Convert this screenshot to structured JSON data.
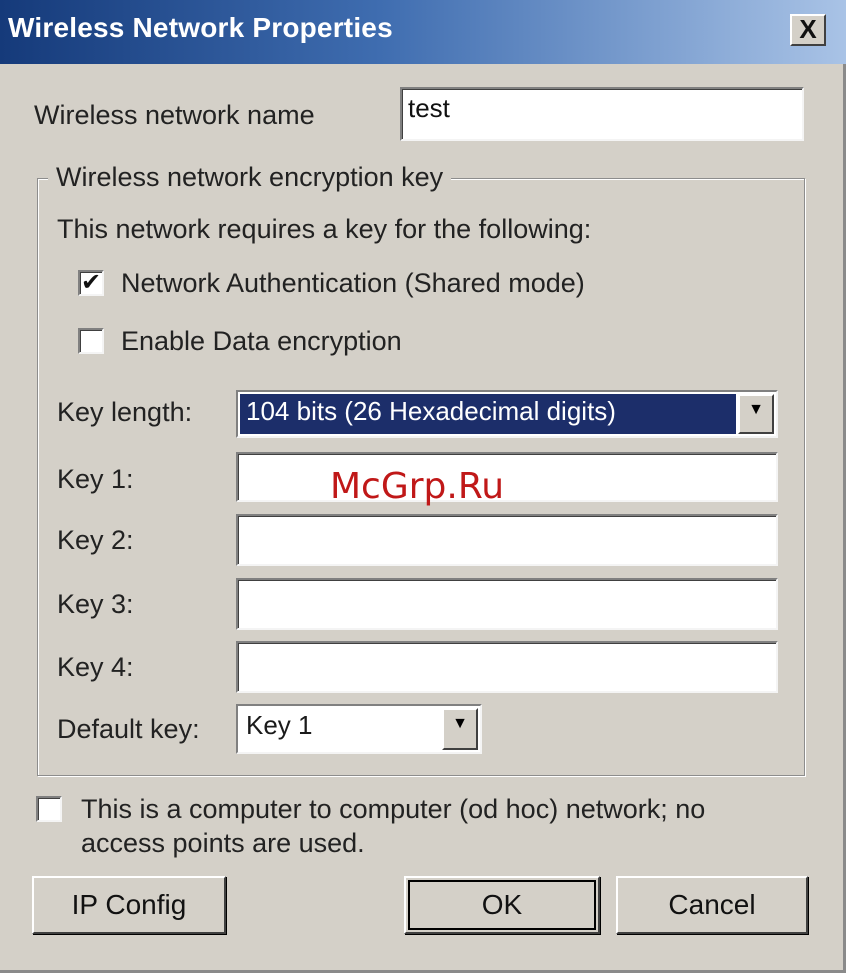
{
  "window": {
    "title": "Wireless Network Properties",
    "close_label": "X"
  },
  "network_name": {
    "label": "Wireless network name",
    "value": "test"
  },
  "encryption": {
    "group_label": "Wireless network encryption key",
    "intro": "This network requires a key for the following:",
    "network_auth": {
      "label": "Network  Authentication (Shared mode)",
      "checked": true,
      "check_glyph": "✔"
    },
    "data_encryption": {
      "label": "Enable Data encryption",
      "checked": false,
      "check_glyph": ""
    },
    "key_length": {
      "label": "Key length:",
      "value": "104 bits (26 Hexadecimal digits)"
    },
    "keys": [
      {
        "label": "Key 1:",
        "value": ""
      },
      {
        "label": "Key 2:",
        "value": ""
      },
      {
        "label": "Key 3:",
        "value": ""
      },
      {
        "label": "Key 4:",
        "value": ""
      }
    ],
    "default_key": {
      "label": "Default key:",
      "value": "Key 1"
    }
  },
  "adhoc": {
    "label_line1": "This is a computer to computer (od hoc) network; no",
    "label_line2": "access points are used.",
    "checked": false,
    "check_glyph": ""
  },
  "buttons": {
    "ip_config": "IP Config",
    "ok": "OK",
    "cancel": "Cancel"
  },
  "watermark": "McGrp.Ru",
  "icons": {
    "dropdown_arrow": "▼"
  },
  "colors": {
    "title_gradient_start": "#153a7a",
    "selection_highlight": "#1c2e6a",
    "dialog_face": "#d4d0c8",
    "watermark": "#c01818"
  }
}
